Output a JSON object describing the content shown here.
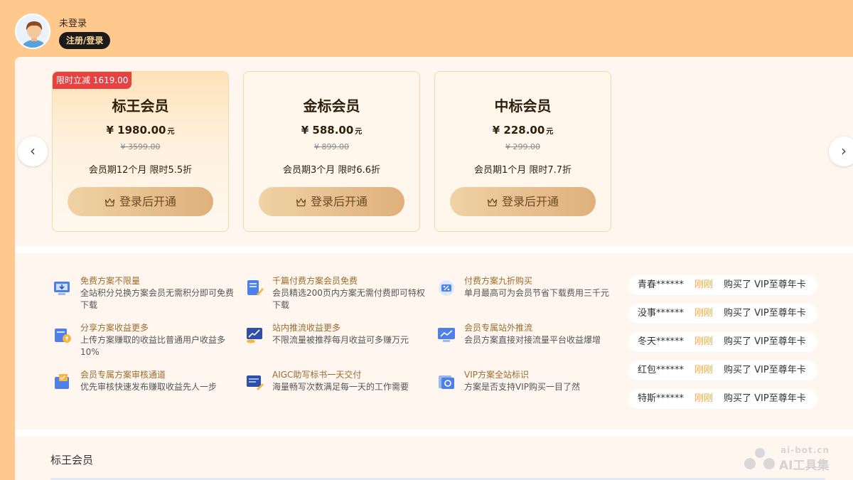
{
  "user": {
    "status": "未登录",
    "login_button": "注册/登录"
  },
  "plans": [
    {
      "badge": "限时立减 1619.00",
      "name": "标王会员",
      "price": "¥ 1980.00",
      "unit": "元",
      "original_price": "¥ 3599.00",
      "desc": "会员期12个月 限时5.5折",
      "button": "登录后开通"
    },
    {
      "name": "金标会员",
      "price": "¥ 588.00",
      "unit": "元",
      "original_price": "¥ 899.00",
      "desc": "会员期3个月 限时6.6折",
      "button": "登录后开通"
    },
    {
      "name": "中标会员",
      "price": "¥ 228.00",
      "unit": "元",
      "original_price": "¥ 299.00",
      "desc": "会员期1个月 限时7.7折",
      "button": "登录后开通"
    }
  ],
  "nav": {
    "prev": "‹",
    "next": "›"
  },
  "features": [
    {
      "title": "免费方案不限量",
      "desc": "全站积分兑换方案会员无需积分即可免费下载",
      "icon": "download-monitor-icon"
    },
    {
      "title": "千篇付费方案会员免费",
      "desc": "会员精选200页内方案无需付费即可特权下载",
      "icon": "document-pen-icon"
    },
    {
      "title": "付费方案九折购买",
      "desc": "单月最高可为会员节省下载费用三千元",
      "icon": "discount-chip-icon"
    },
    {
      "title": "分享方案收益更多",
      "desc": "上传方案赚取的收益比普通用户收益多10%",
      "icon": "share-coin-icon"
    },
    {
      "title": "站内推流收益更多",
      "desc": "不限流量被推荐每月收益可多赚万元",
      "icon": "chart-growth-icon"
    },
    {
      "title": "会员专属站外推流",
      "desc": "会员方案直接对接流量平台收益爆增",
      "icon": "screen-broadcast-icon"
    },
    {
      "title": "会员专属方案审核通道",
      "desc": "优先审核快速发布赚取收益先人一步",
      "icon": "review-box-icon"
    },
    {
      "title": "AIGC助写标书一天交付",
      "desc": "海量畅写次数满足每一天的工作需要",
      "icon": "ai-writing-icon"
    },
    {
      "title": "VIP方案全站标识",
      "desc": "方案是否支持VIP购买一目了然",
      "icon": "vip-tag-icon"
    }
  ],
  "purchases": [
    {
      "name": "青春******",
      "time": "刚刚",
      "action": "购买了 VIP至尊年卡"
    },
    {
      "name": "没事******",
      "time": "刚刚",
      "action": "购买了 VIP至尊年卡"
    },
    {
      "name": "冬天******",
      "time": "刚刚",
      "action": "购买了 VIP至尊年卡"
    },
    {
      "name": "红包******",
      "time": "刚刚",
      "action": "购买了 VIP至尊年卡"
    },
    {
      "name": "特斯******",
      "time": "刚刚",
      "action": "购买了 VIP至尊年卡"
    }
  ],
  "section": {
    "title": "标王会员"
  },
  "watermark": {
    "top": "ai-bot.cn",
    "bottom": "AI工具集"
  },
  "colors": {
    "background": "#ffc98e",
    "panel": "#fff7ef",
    "badge": "#e84142",
    "accent": "#f3a93a",
    "button": "#dfb07a"
  }
}
